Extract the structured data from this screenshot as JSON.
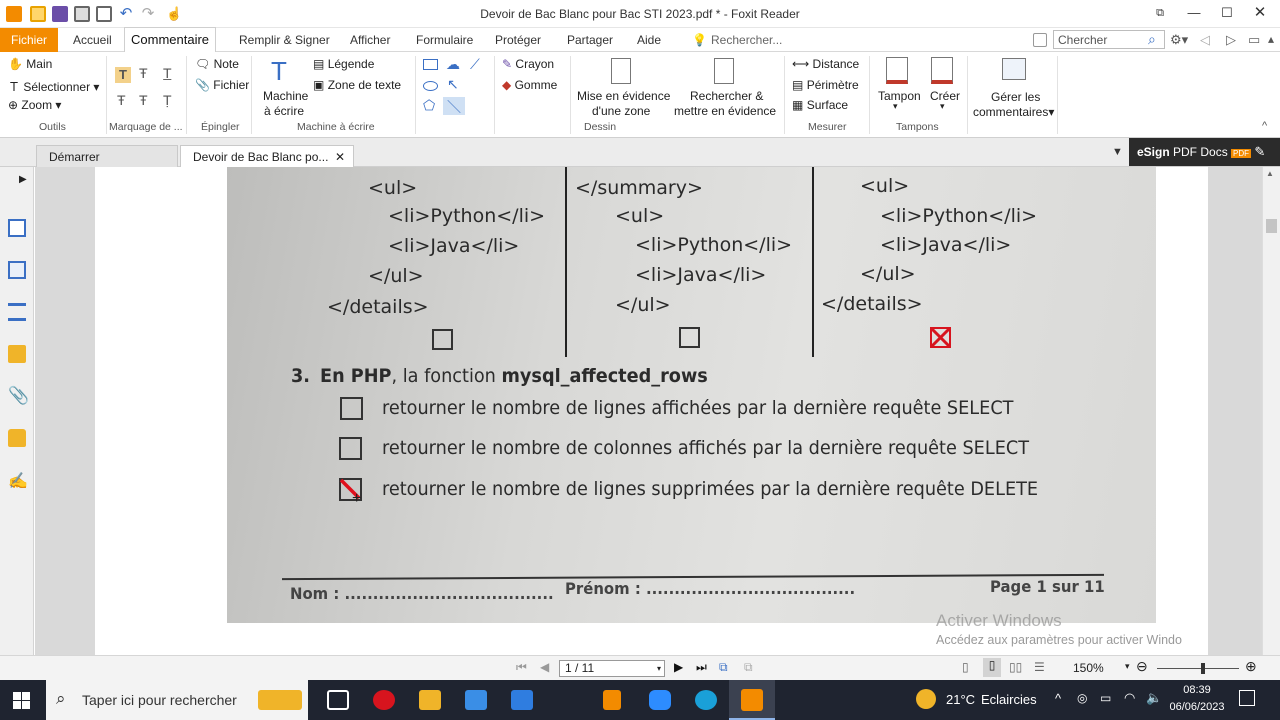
{
  "window": {
    "title": "Devoir de Bac Blanc pour Bac STI 2023.pdf * - Foxit Reader"
  },
  "ribbon_tabs": [
    "Fichier",
    "Accueil",
    "Commentaire",
    "Remplir & Signer",
    "Afficher",
    "Formulaire",
    "Protéger",
    "Partager",
    "Aide"
  ],
  "tell_me": "Rechercher...",
  "search": {
    "placeholder": "Chercher"
  },
  "ribbon": {
    "outils": {
      "main": "Main",
      "select": "Sélectionner",
      "zoom": "Zoom",
      "group": "Outils"
    },
    "marquage": {
      "group": "Marquage de ..."
    },
    "epingler": {
      "note": "Note",
      "fichier": "Fichier",
      "group": "Épingler"
    },
    "machine": {
      "label1": "Machine",
      "label2": "à écrire",
      "legende": "Légende",
      "zone": "Zone de texte",
      "group": "Machine à écrire"
    },
    "dessin": {
      "crayon": "Crayon",
      "gomme": "Gomme",
      "mise1": "Mise en évidence",
      "mise2": "d'une zone",
      "rech1": "Rechercher &",
      "rech2": "mettre en évidence",
      "group": "Dessin"
    },
    "mesurer": {
      "distance": "Distance",
      "perimetre": "Périmètre",
      "surface": "Surface",
      "group": "Mesurer"
    },
    "tampons": {
      "tampon": "Tampon",
      "creer": "Créer",
      "group": "Tampons"
    },
    "gerer": {
      "label1": "Gérer les",
      "label2": "commentaires"
    }
  },
  "doc_tabs": {
    "start": "Démarrer",
    "current": "Devoir de Bac Blanc po..."
  },
  "esign": {
    "label_bold": "eSign",
    "label": "PDF Docs",
    "badge": "PDF"
  },
  "document": {
    "col1": [
      "<ul>",
      "<li>Python</li>",
      "<li>Java</li>",
      "</ul>",
      "</details>"
    ],
    "col2": [
      "</summary>",
      "<ul>",
      "<li>Python</li>",
      "<li>Java</li>",
      "</ul>"
    ],
    "col3": [
      "<ul>",
      "<li>Python</li>",
      "<li>Java</li>",
      "</ul>",
      "</details>"
    ],
    "q3_num": "3.",
    "q3_lead": "En PHP",
    "q3_mid": ", la fonction ",
    "q3_func": "mysql_affected_rows",
    "options": [
      "retourner le nombre de lignes affichées par la dernière requête SELECT",
      "retourner le nombre de colonnes affichés par  la dernière requête SELECT",
      "retourner le nombre de lignes supprimées par la dernière requête DELETE"
    ],
    "footer_nom": "Nom : .....................................",
    "footer_prenom": "Prénom : .....................................",
    "footer_page": "Page 1 sur 11"
  },
  "status": {
    "page": "1 / 11",
    "zoom": "150%"
  },
  "activate": {
    "line1": "Activer Windows",
    "line2": "Accédez aux paramètres pour activer Windo"
  },
  "taskbar": {
    "search": "Taper ici pour rechercher",
    "weather_temp": "21°C",
    "weather_desc": "Eclaircies",
    "time": "08:39",
    "date": "06/06/2023"
  },
  "colors": {
    "brand_orange": "#f38b00",
    "taskbar": "#1f2430",
    "check_red": "#d7141e"
  }
}
